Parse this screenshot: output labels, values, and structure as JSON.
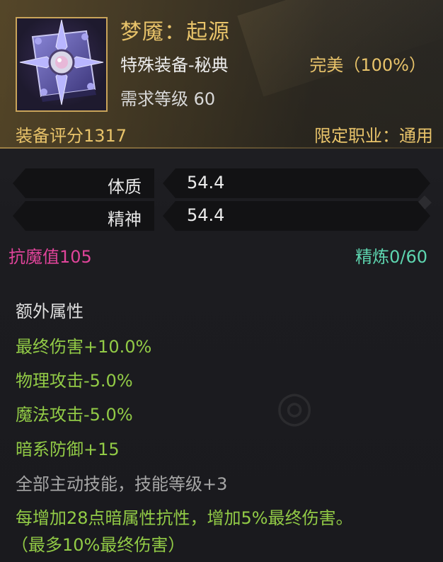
{
  "item": {
    "title": "梦魇：起源",
    "subtype": "特殊装备-秘典",
    "quality": "完美（100%）",
    "required_level": "需求等级 60",
    "score": "装备评分1317",
    "job": "限定职业：通用",
    "icon": "spellbook-icon"
  },
  "stats": [
    {
      "label": "体质",
      "value": "54.4"
    },
    {
      "label": "精神",
      "value": "54.4"
    }
  ],
  "anti_magic": "抗魔值105",
  "refine": "精炼0/60",
  "extra": {
    "heading": "额外属性",
    "attributes": [
      "最终伤害+10.0%",
      "物理攻击-5.0%",
      "魔法攻击-5.0%",
      "暗系防御+15",
      "全部主动技能，技能等级+3",
      "每增加28点暗属性抗性，增加5%最终伤害。",
      "（最多10%最终伤害）"
    ]
  },
  "colors": {
    "gold": "#e8c36a",
    "green": "#92cb46",
    "pink": "#e0449a",
    "teal": "#5ed6b0",
    "grey": "#a6a6a6"
  }
}
